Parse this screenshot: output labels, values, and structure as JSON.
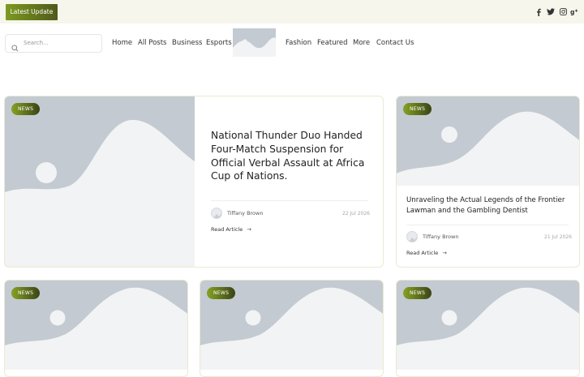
{
  "topbar": {
    "latest_label": "Latest Update",
    "social_icons": [
      "facebook-icon",
      "twitter-icon",
      "instagram-icon",
      "google-plus-icon"
    ]
  },
  "search": {
    "placeholder": "Search..."
  },
  "nav": {
    "items": [
      "Home",
      "All Posts",
      "Business",
      "Esports",
      "Fashion",
      "Featured",
      "More",
      "Contact Us"
    ]
  },
  "colors": {
    "accent_start": "#86a224",
    "accent_end": "#3b4316",
    "topbar_bg": "#f7f6ec",
    "placeholder_bg": "#c3cad1",
    "placeholder_fg": "#f2f3f4"
  },
  "featured": {
    "badge": "NEWS",
    "title": "National Thunder Duo Handed Four-Match Suspension for Official Verbal Assault at Africa Cup of Nations.",
    "author": "Tiffany Brown",
    "date": "22 Jul 2026",
    "read_more": "Read Article"
  },
  "side_article": {
    "badge": "NEWS",
    "title": "Unraveling the Actual Legends of the Frontier Lawman and the Gambling Dentist",
    "author": "Tiffany Brown",
    "date": "21 Jul 2026",
    "read_more": "Read Article"
  },
  "bottom_cards": [
    {
      "badge": "NEWS"
    },
    {
      "badge": "NEWS"
    },
    {
      "badge": "NEWS"
    }
  ]
}
